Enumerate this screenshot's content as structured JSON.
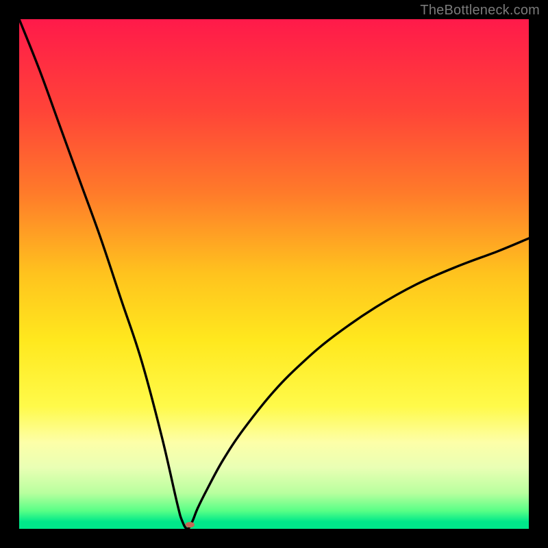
{
  "watermark": "TheBottleneck.com",
  "chart_data": {
    "type": "line",
    "title": "",
    "xlabel": "",
    "ylabel": "",
    "xlim": [
      0,
      100
    ],
    "ylim": [
      0,
      100
    ],
    "curve": {
      "name": "bottleneck-curve",
      "x_min_at": 33,
      "left_start_y": 100,
      "description": "V-shaped curve: steep near-linear drop from top-left to a minimum near x≈33 at y≈0, then a concave rise toward the right reaching y≈57 at x=100",
      "x": [
        0,
        4,
        8,
        12,
        16,
        20,
        24,
        28,
        31,
        32,
        33,
        34,
        35,
        37,
        40,
        44,
        50,
        56,
        62,
        70,
        78,
        86,
        94,
        100
      ],
      "y": [
        100,
        90,
        79,
        68,
        57,
        45,
        33,
        18,
        5,
        1.5,
        0,
        1.5,
        4,
        8,
        13.5,
        19.5,
        27,
        33,
        38,
        43.5,
        48,
        51.5,
        54.5,
        57
      ]
    },
    "marker": {
      "x": 33.5,
      "y": 0.8,
      "rx": 0.9,
      "ry": 0.55,
      "color": "#c46a57"
    },
    "gradient_stops": [
      {
        "pct": 0,
        "color": "#ff1a4a"
      },
      {
        "pct": 18,
        "color": "#ff4438"
      },
      {
        "pct": 34,
        "color": "#ff7a2a"
      },
      {
        "pct": 50,
        "color": "#ffc31e"
      },
      {
        "pct": 63,
        "color": "#ffe81e"
      },
      {
        "pct": 76,
        "color": "#fffa4a"
      },
      {
        "pct": 83,
        "color": "#fdffa8"
      },
      {
        "pct": 88,
        "color": "#e9ffb4"
      },
      {
        "pct": 93,
        "color": "#b8ff9e"
      },
      {
        "pct": 96.5,
        "color": "#57ff86"
      },
      {
        "pct": 98.6,
        "color": "#00e88a"
      },
      {
        "pct": 100,
        "color": "#00e88a"
      }
    ]
  }
}
